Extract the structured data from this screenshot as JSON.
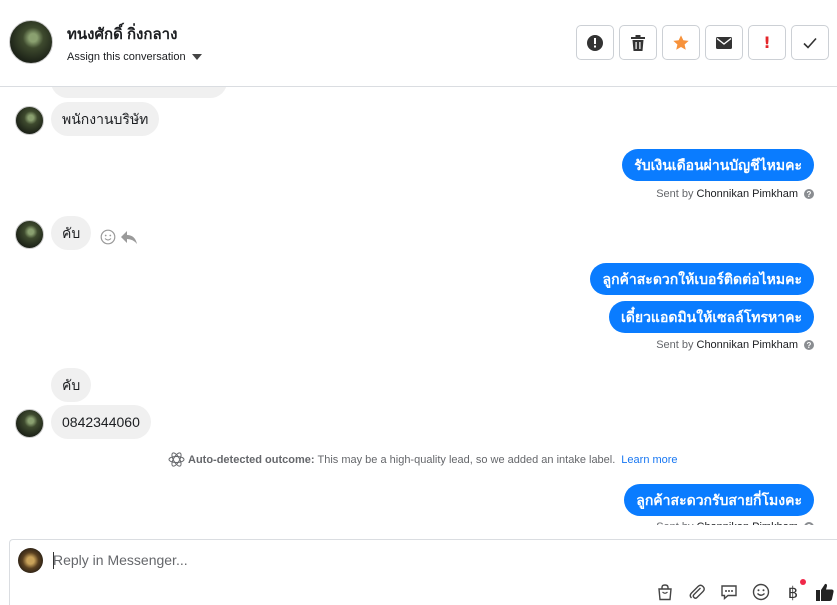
{
  "header": {
    "contact_name": "ทนงศักดิ์ กิ่งกลาง",
    "assign_label": "Assign this conversation",
    "actions": [
      {
        "icon": "spam-report-icon"
      },
      {
        "icon": "trash-icon"
      },
      {
        "icon": "star-icon"
      },
      {
        "icon": "mail-icon"
      },
      {
        "icon": "important-icon",
        "label": "!"
      },
      {
        "icon": "checkmark-icon"
      }
    ]
  },
  "messages": {
    "m1_in": "พนักงานบริษัท",
    "m2_out": "รับเงินเดือนผ่านบัญชีไหมคะ",
    "sent_by_prefix": "Sent by",
    "sent_by_name": "Chonnikan Pimkham",
    "m3_in": "คับ",
    "m4_out": "ลูกค้าสะดวกให้เบอร์ติดต่อไหมคะ",
    "m5_out": "เดี๋ยวแอดมินให้เซลล์โทรหาคะ",
    "m6_in": "คับ",
    "m7_in": "0842344060",
    "auto_detected_label": "Auto-detected outcome:",
    "auto_detected_text": "This may be a high-quality lead, so we added an intake label.",
    "learn_more": "Learn more",
    "m8_out": "ลูกค้าสะดวกรับสายกี่โมงคะ",
    "question_mark": "?"
  },
  "composer": {
    "placeholder": "Reply in Messenger...",
    "baht_symbol": "฿"
  },
  "colors": {
    "outgoing_bubble": "#0a7cff",
    "incoming_bubble": "#f0f0f0",
    "star": "#f7923b",
    "important": "#e4262a",
    "link": "#1877f2"
  }
}
